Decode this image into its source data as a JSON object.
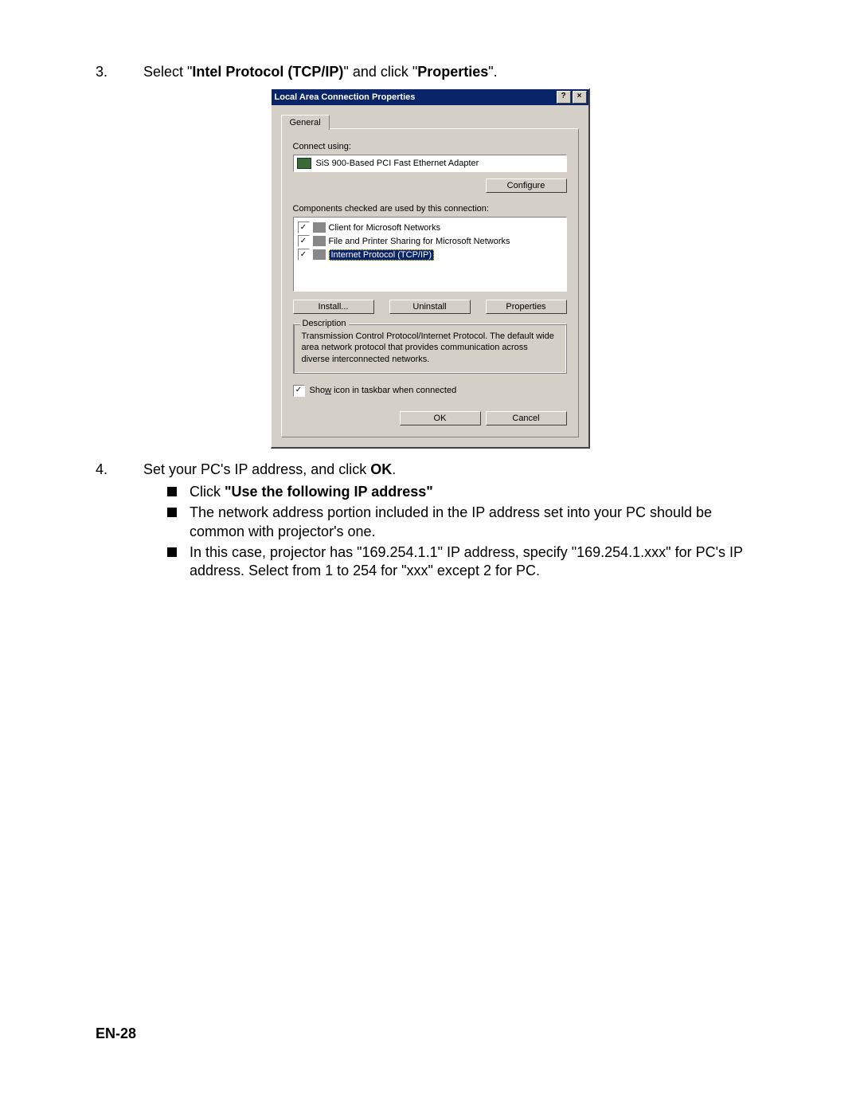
{
  "step3": {
    "num": "3.",
    "prefix": "Select \"",
    "bold1": "Intel Protocol (TCP/IP)",
    "mid": "\" and click \"",
    "bold2": "Properties",
    "suffix": "\"."
  },
  "step4": {
    "num": "4.",
    "prefix": "Set your PC's IP address, and click ",
    "bold": "OK",
    "suffix": "."
  },
  "bullets": {
    "b1_prefix": "Click ",
    "b1_bold": "\"Use the following IP address\"",
    "b2": "The network address portion included in the IP address set into your PC should be common with projector's one.",
    "b3": "In this case, projector has \"169.254.1.1\" IP address, specify \"169.254.1.xxx\" for PC's IP address. Select from 1 to 254 for \"xxx\" except 2 for PC."
  },
  "dialog": {
    "title": "Local Area Connection Properties",
    "tab": "General",
    "connect_using": "Connect using:",
    "adapter": "SiS 900-Based PCI Fast Ethernet Adapter",
    "configure": "Configure",
    "components_label": "Components checked are used by this connection:",
    "items": {
      "client": "Client for Microsoft Networks",
      "fileprint": "File and Printer Sharing for Microsoft Networks",
      "tcpip": "Internet Protocol (TCP/IP)"
    },
    "install": "Install...",
    "uninstall": "Uninstall",
    "properties": "Properties",
    "desc_title": "Description",
    "desc_text": "Transmission Control Protocol/Internet Protocol. The default wide area network protocol that provides communication across diverse interconnected networks.",
    "show_icon_prefix": "Sho",
    "show_icon_accel": "w",
    "show_icon_suffix": " icon in taskbar when connected",
    "ok": "OK",
    "cancel": "Cancel"
  },
  "page_number": "EN-28"
}
